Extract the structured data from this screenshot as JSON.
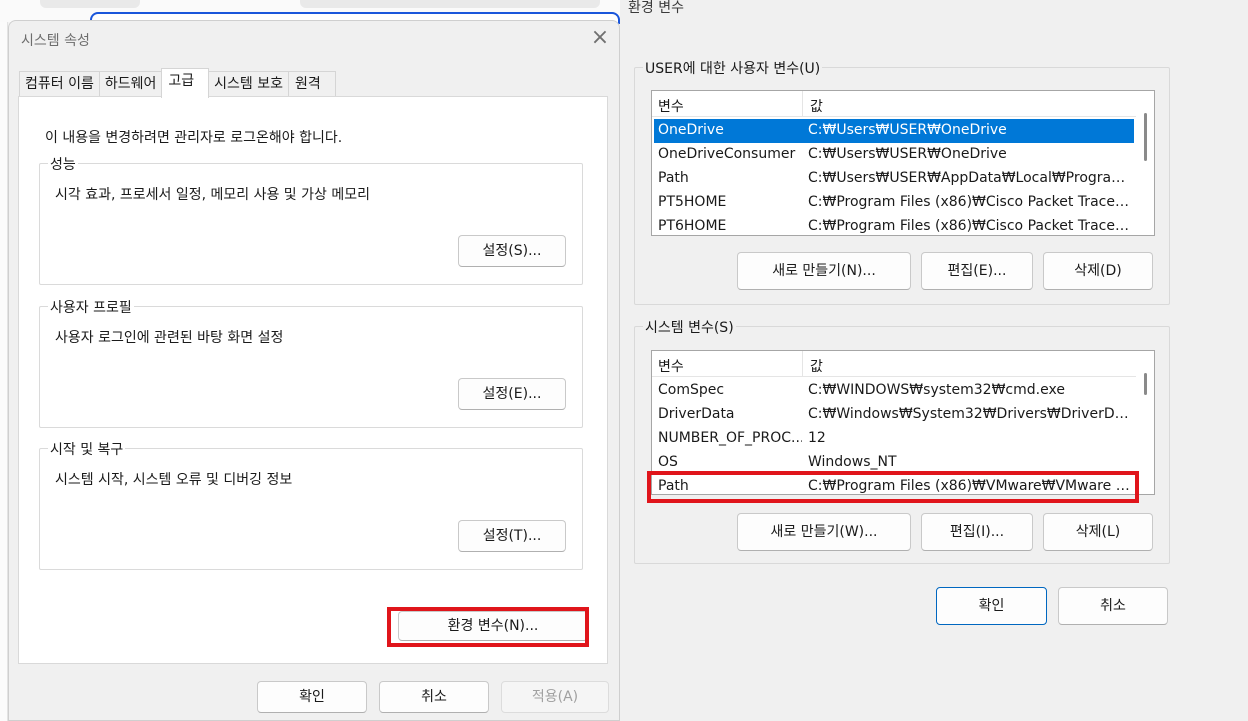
{
  "system_properties": {
    "title": "시스템 속성",
    "tabs": [
      {
        "label": "컴퓨터 이름",
        "active": false
      },
      {
        "label": "하드웨어",
        "active": false
      },
      {
        "label": "고급",
        "active": true
      },
      {
        "label": "시스템 보호",
        "active": false
      },
      {
        "label": "원격",
        "active": false
      }
    ],
    "admin_note": "이 내용을 변경하려면 관리자로 로그온해야 합니다.",
    "performance": {
      "title": "성능",
      "description": "시각 효과, 프로세서 일정, 메모리 사용 및 가상 메모리",
      "button": "설정(S)..."
    },
    "user_profiles": {
      "title": "사용자 프로필",
      "description": "사용자 로그인에 관련된 바탕 화면 설정",
      "button": "설정(E)..."
    },
    "startup_recovery": {
      "title": "시작 및 복구",
      "description": "시스템 시작, 시스템 오류 및 디버깅 정보",
      "button": "설정(T)..."
    },
    "env_vars_button": "환경 변수(N)...",
    "footer": {
      "ok": "확인",
      "cancel": "취소",
      "apply": "적용(A)"
    }
  },
  "environment_variables": {
    "title": "환경 변수",
    "user_vars": {
      "title": "USER에 대한 사용자 변수(U)",
      "columns": [
        "변수",
        "값"
      ],
      "rows": [
        {
          "name": "OneDrive",
          "value": "C:₩Users₩USER₩OneDrive",
          "selected": true
        },
        {
          "name": "OneDriveConsumer",
          "value": "C:₩Users₩USER₩OneDrive",
          "selected": false
        },
        {
          "name": "Path",
          "value": "C:₩Users₩USER₩AppData₩Local₩Programs...",
          "selected": false
        },
        {
          "name": "PT5HOME",
          "value": "C:₩Program Files (x86)₩Cisco Packet Tracer ...",
          "selected": false
        },
        {
          "name": "PT6HOME",
          "value": "C:₩Program Files (x86)₩Cisco Packet Tracer ...",
          "selected": false
        }
      ],
      "buttons": {
        "new": "새로 만들기(N)...",
        "edit": "편집(E)...",
        "delete": "삭제(D)"
      }
    },
    "system_vars": {
      "title": "시스템 변수(S)",
      "columns": [
        "변수",
        "값"
      ],
      "rows": [
        {
          "name": "ComSpec",
          "value": "C:₩WINDOWS₩system32₩cmd.exe",
          "selected": false
        },
        {
          "name": "DriverData",
          "value": "C:₩Windows₩System32₩Drivers₩DriverData",
          "selected": false
        },
        {
          "name": "NUMBER_OF_PROC...",
          "value": "12",
          "selected": false
        },
        {
          "name": "OS",
          "value": "Windows_NT",
          "selected": false
        },
        {
          "name": "Path",
          "value": "C:₩Program Files (x86)₩VMware₩VMware W...",
          "selected": false
        }
      ],
      "buttons": {
        "new": "새로 만들기(W)...",
        "edit": "편집(I)...",
        "delete": "삭제(L)"
      }
    },
    "footer": {
      "ok": "확인",
      "cancel": "취소"
    }
  },
  "colors": {
    "highlight": "#e0151b",
    "selection": "#0078d7",
    "primary_border": "#0067c0"
  }
}
